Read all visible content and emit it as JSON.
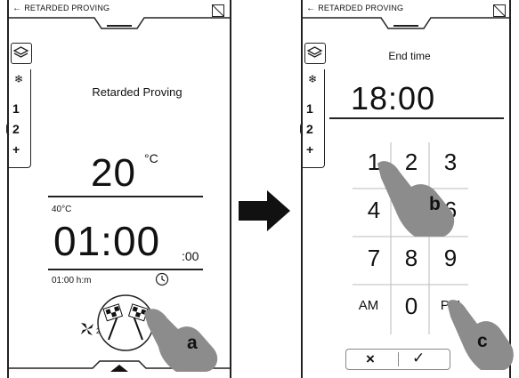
{
  "screen1": {
    "back_label": "RETARDED PROVING",
    "tabs": [
      "1",
      "2",
      "+"
    ],
    "title": "Retarded Proving",
    "temperature": "20",
    "temp_unit": "°C",
    "probe_temp": "40°C",
    "time_main": "01:00",
    "time_seconds": ":00",
    "time_format": "01:00 h:m",
    "fan_level": "2",
    "callout": "a"
  },
  "screen2": {
    "back_label": "RETARDED PROVING",
    "tabs": [
      "1",
      "2",
      "+"
    ],
    "title": "End time",
    "end_time": "18:00",
    "keys": [
      "1",
      "2",
      "3",
      "4",
      "5",
      "6",
      "7",
      "8",
      "9",
      "AM",
      "0",
      "PM"
    ],
    "cancel_label": "×",
    "confirm_label": "✓",
    "callout_b": "b",
    "callout_c": "c"
  },
  "icons": [
    "back-arrow-icon",
    "layers-icon",
    "snowflake-icon",
    "clock-icon",
    "fan-icon",
    "checkered-flags-icon",
    "arrow-right-icon",
    "hand-pointer-icon"
  ]
}
